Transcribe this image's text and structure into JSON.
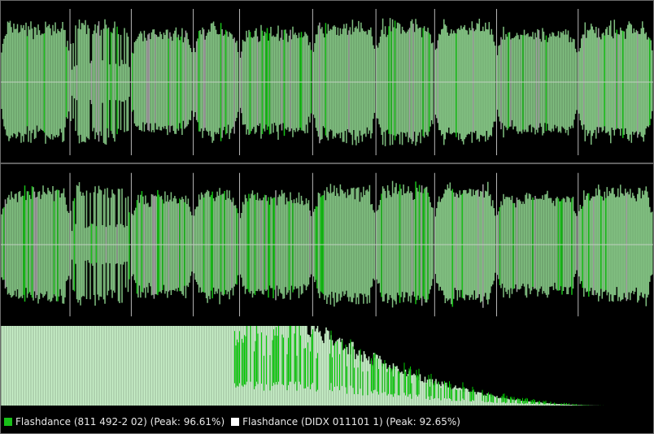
{
  "colors": {
    "track1": "#18c018",
    "track2": "#ffffff",
    "waveform_fill": "#80bf80",
    "waveform_overlap_edge": "#a0a0a0",
    "spectrum_fill": "#c8f0c8",
    "spectrum_peak": "#00cc00",
    "background": "#000000",
    "centerline": "#c0d0c0"
  },
  "legend": [
    {
      "label": "Flashdance (811 492-2 02) (Peak: 96.61%)",
      "color": "#18c018"
    },
    {
      "label": "Flashdance (DIDX 011101 1) (Peak: 92.65%)",
      "color": "#ffffff"
    }
  ],
  "waveform": {
    "channels": [
      "left",
      "right"
    ],
    "segments": [
      {
        "start": 0.0,
        "end": 0.106,
        "amplitude": 0.78
      },
      {
        "start": 0.106,
        "end": 0.2,
        "amplitude": 0.82,
        "sparse": true
      },
      {
        "start": 0.2,
        "end": 0.295,
        "amplitude": 0.7
      },
      {
        "start": 0.295,
        "end": 0.366,
        "amplitude": 0.76
      },
      {
        "start": 0.366,
        "end": 0.478,
        "amplitude": 0.72
      },
      {
        "start": 0.478,
        "end": 0.575,
        "amplitude": 0.8
      },
      {
        "start": 0.575,
        "end": 0.665,
        "amplitude": 0.82
      },
      {
        "start": 0.665,
        "end": 0.76,
        "amplitude": 0.8
      },
      {
        "start": 0.76,
        "end": 0.885,
        "amplitude": 0.7
      },
      {
        "start": 0.885,
        "end": 1.0,
        "amplitude": 0.78
      }
    ]
  },
  "spectrum": {
    "flat_until": 0.47,
    "end_at": 0.93,
    "level": 1.0
  }
}
